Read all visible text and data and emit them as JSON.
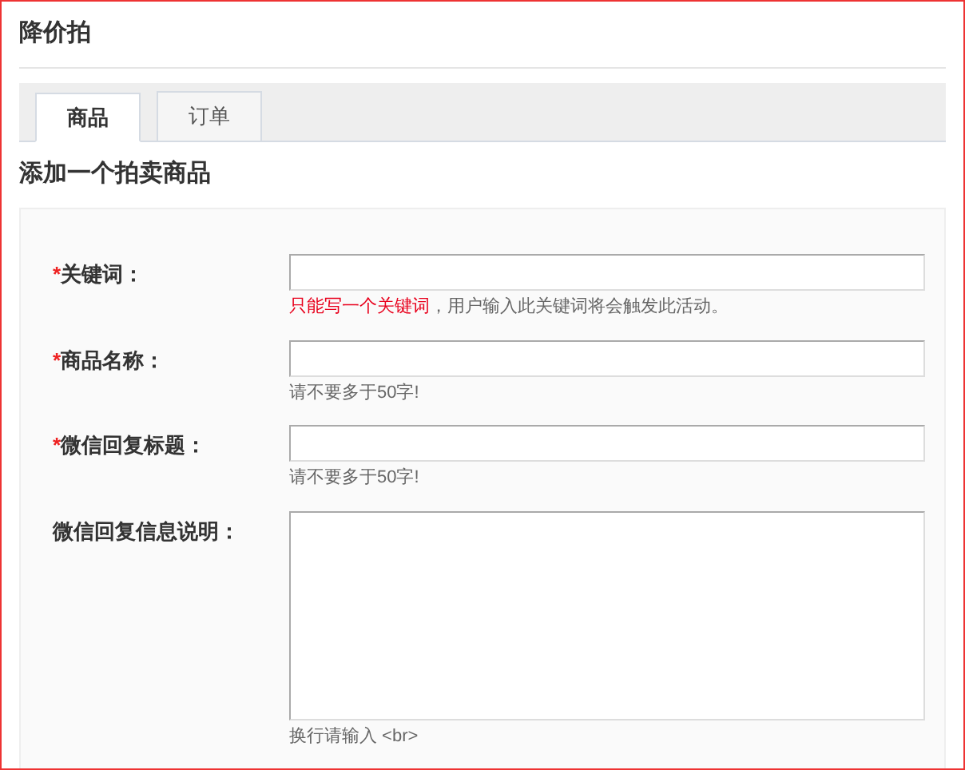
{
  "title": "降价拍",
  "tabs": [
    {
      "label": "商品",
      "selected": true
    },
    {
      "label": "订单",
      "selected": false
    }
  ],
  "section_title": "添加一个拍卖商品",
  "fields": [
    {
      "kind": "input",
      "label": "关键词：",
      "required": true,
      "hint": [
        {
          "text": "只能写一个关键词",
          "emphasis": true
        },
        {
          "text": "，用户输入此关键词将会触发此活动。",
          "emphasis": false
        }
      ]
    },
    {
      "kind": "input",
      "label": "商品名称：",
      "required": true,
      "hint": [
        {
          "text": "请不要多于50字!",
          "emphasis": false
        }
      ]
    },
    {
      "kind": "input",
      "label": "微信回复标题：",
      "required": true,
      "hint": [
        {
          "text": "请不要多于50字!",
          "emphasis": false
        }
      ]
    },
    {
      "kind": "textarea",
      "label": "微信回复信息说明：",
      "required": false,
      "hint": [
        {
          "text": "换行请输入 <br>",
          "emphasis": false
        }
      ]
    }
  ],
  "required_mark": "*"
}
